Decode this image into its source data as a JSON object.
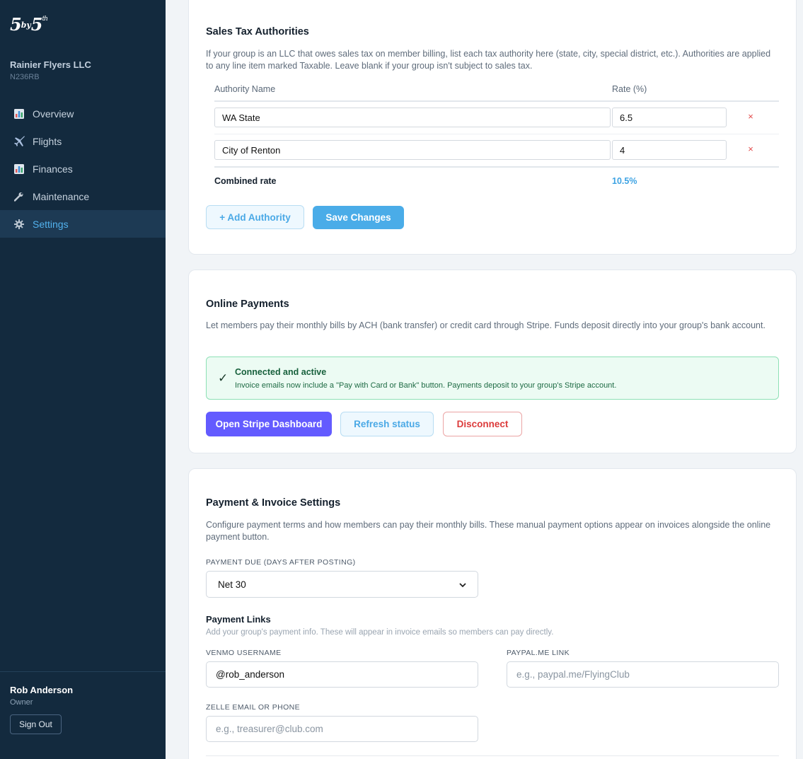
{
  "sidebar": {
    "logo": {
      "main": "5",
      "mid": "by",
      "end": "5",
      "sup": "th"
    },
    "org_name": "Rainier Flyers LLC",
    "org_tail": "N236RB",
    "nav": [
      {
        "label": "Overview",
        "icon": "bar-chart-icon",
        "active": false
      },
      {
        "label": "Flights",
        "icon": "airplane-icon",
        "active": false
      },
      {
        "label": "Finances",
        "icon": "bar-chart-icon",
        "active": false
      },
      {
        "label": "Maintenance",
        "icon": "wrench-icon",
        "active": false
      },
      {
        "label": "Settings",
        "icon": "gear-icon",
        "active": true
      }
    ],
    "user": {
      "name": "Rob Anderson",
      "role": "Owner",
      "signout_label": "Sign Out"
    }
  },
  "sales_tax": {
    "title": "Sales Tax Authorities",
    "description": "If your group is an LLC that owes sales tax on member billing, list each tax authority here (state, city, special district, etc.). Authorities are applied to any line item marked Taxable. Leave blank if your group isn't subject to sales tax.",
    "col_name": "Authority Name",
    "col_rate": "Rate (%)",
    "rows": [
      {
        "name": "WA State",
        "rate": "6.5",
        "remove": "×"
      },
      {
        "name": "City of Renton",
        "rate": "4",
        "remove": "×"
      }
    ],
    "combined_label": "Combined rate",
    "combined_value": "10.5%",
    "add_label": "+ Add Authority",
    "save_label": "Save Changes"
  },
  "online_payments": {
    "title": "Online Payments",
    "description": "Let members pay their monthly bills by ACH (bank transfer) or credit card through Stripe. Funds deposit directly into your group's bank account.",
    "status_check": "✓",
    "status_title": "Connected and active",
    "status_text": "Invoice emails now include a \"Pay with Card or Bank\" button. Payments deposit to your group's Stripe account.",
    "open_stripe_label": "Open Stripe Dashboard",
    "refresh_label": "Refresh status",
    "disconnect_label": "Disconnect",
    "colors": {
      "stripe": "#635bff",
      "success_bg": "#ecfbf3",
      "danger": "#dc3b3b"
    }
  },
  "invoice_settings": {
    "title": "Payment & Invoice Settings",
    "description": "Configure payment terms and how members can pay their monthly bills. These manual payment options appear on invoices alongside the online payment button.",
    "due_label": "Payment Due (Days After Posting)",
    "due_value": "Net 30",
    "links_title": "Payment Links",
    "links_desc": "Add your group's payment info. These will appear in invoice emails so members can pay directly.",
    "venmo_label": "Venmo Username",
    "venmo_value": "@rob_anderson",
    "paypal_label": "PayPal.me Link",
    "paypal_placeholder": "e.g., paypal.me/FlyingClub",
    "zelle_label": "Zelle Email or Phone",
    "zelle_placeholder": "e.g., treasurer@club.com"
  },
  "colors": {
    "sidebar_bg": "#132a3e",
    "accent": "#4aace8",
    "active_nav": "#52b2ee"
  }
}
